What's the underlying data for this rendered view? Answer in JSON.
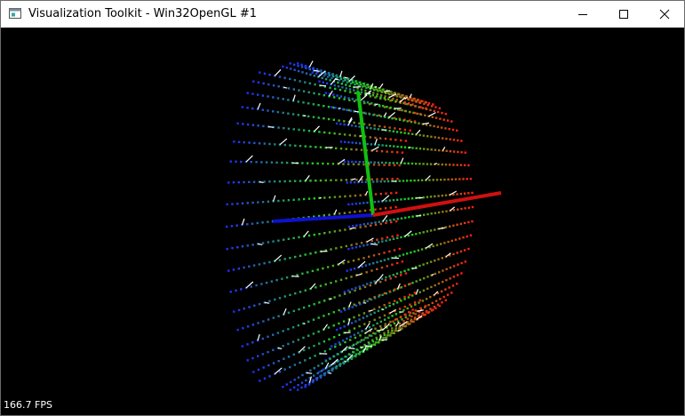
{
  "window": {
    "title": "Visualization Toolkit - Win32OpenGL #1",
    "icons": {
      "app": "app-window-icon",
      "minimize": "minimize-icon",
      "maximize": "maximize-icon",
      "close": "close-icon"
    }
  },
  "render": {
    "background": "#000000",
    "fps_label": "166.7 FPS",
    "axes": {
      "x_color": "#d01010",
      "y_color": "#10c010",
      "z_color": "#1010d0"
    },
    "point_colors": [
      "#2030ff",
      "#20d020",
      "#ff2010"
    ],
    "glyph_color": "#ffffff"
  }
}
